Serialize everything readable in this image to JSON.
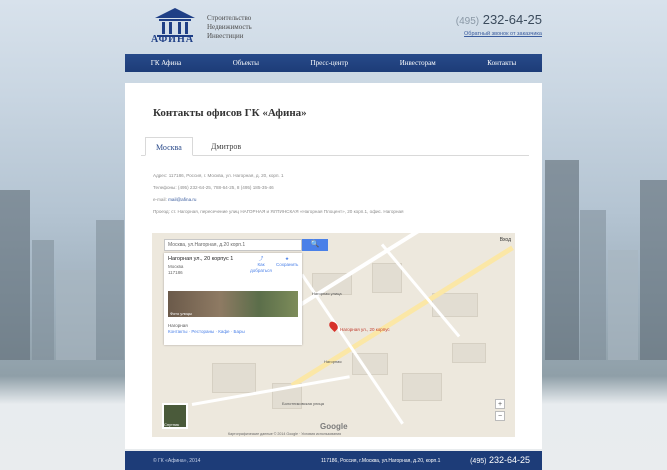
{
  "brand": {
    "name": "АФИНА",
    "tagline": [
      "Строительство",
      "Недвижимость",
      "Инвестиции"
    ]
  },
  "header": {
    "phone_code": "(495)",
    "phone_number": "232-64-25",
    "callback_link": "Обратный звонок от заказчика"
  },
  "nav": {
    "items": [
      "ГК Афина",
      "Объекты",
      "Пресс-центр",
      "Инвесторам",
      "Контакты"
    ]
  },
  "page": {
    "title": "Контакты офисов ГК «Афина»",
    "tabs": [
      "Москва",
      "Дмитров"
    ],
    "info_lines": [
      "Адрес: 117186, Россия, г. Москва, ул. Нагорная, д. 20, корп. 1",
      "Телефоны: (495) 232-64-25, 788-64-25, 8 (495) 185-35-46",
      "e-mail:",
      "Проезд: ст. Нагорная, пересечение улиц НАГОРНАЯ и ЯЛТИНСКАЯ «Нагорная Плоцент», 20 корп.1, офис. Нагорная"
    ],
    "email": "mail@afina.ru"
  },
  "map": {
    "search_value": "Москва, ул.Нагорная, д.20 корп.1",
    "search_btn": "🔍",
    "card_title": "Нагорная ул., 20 корпус 1",
    "card_sub": "Москва\n117186",
    "action_route": "Как добраться",
    "action_save": "Сохранить",
    "photo_label": "Фото улицы",
    "foot_name": "Нагорная",
    "foot_links": "Контакты · Рестораны · Кафе · Бары",
    "pin_label": "Нагорная ул., 20 корпус",
    "top_right": "Вход",
    "labels": [
      "Нагорная улица",
      "Болотниковская улица",
      "Нагорная"
    ],
    "sat_label": "Спутник",
    "google": "Google",
    "footer": "Картографические данные © 2014 Google · Условия использования"
  },
  "footer": {
    "copyright": "© ГК «Афина», 2014",
    "address": "117186, Россия, г.Москва, ул.Нагорная, д.20, корп.1",
    "phone_code": "(495)",
    "phone_number": "232-64-25"
  },
  "colors": {
    "brand_blue": "#1d3c78",
    "accent_link": "#3a5c9e"
  }
}
